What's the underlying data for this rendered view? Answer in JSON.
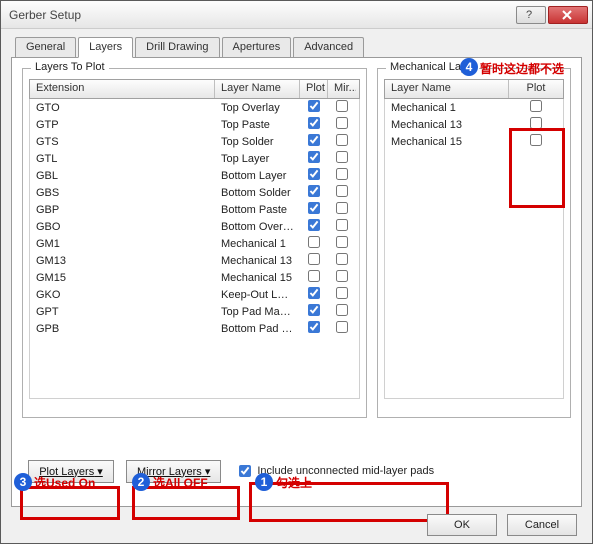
{
  "window": {
    "title": "Gerber Setup"
  },
  "tabs": [
    "General",
    "Layers",
    "Drill Drawing",
    "Apertures",
    "Advanced"
  ],
  "activeTab": "Layers",
  "leftGroup": {
    "legend": "Layers To Plot",
    "headers": {
      "ext": "Extension",
      "lname": "Layer Name",
      "plot": "Plot",
      "mir": "Mir..."
    },
    "rows": [
      {
        "ext": "GTO",
        "lname": "Top Overlay",
        "plot": true,
        "mir": false
      },
      {
        "ext": "GTP",
        "lname": "Top Paste",
        "plot": true,
        "mir": false
      },
      {
        "ext": "GTS",
        "lname": "Top Solder",
        "plot": true,
        "mir": false
      },
      {
        "ext": "GTL",
        "lname": "Top Layer",
        "plot": true,
        "mir": false
      },
      {
        "ext": "GBL",
        "lname": "Bottom Layer",
        "plot": true,
        "mir": false
      },
      {
        "ext": "GBS",
        "lname": "Bottom Solder",
        "plot": true,
        "mir": false
      },
      {
        "ext": "GBP",
        "lname": "Bottom Paste",
        "plot": true,
        "mir": false
      },
      {
        "ext": "GBO",
        "lname": "Bottom Overlay",
        "plot": true,
        "mir": false
      },
      {
        "ext": "GM1",
        "lname": "Mechanical 1",
        "plot": false,
        "mir": false
      },
      {
        "ext": "GM13",
        "lname": "Mechanical 13",
        "plot": false,
        "mir": false
      },
      {
        "ext": "GM15",
        "lname": "Mechanical 15",
        "plot": false,
        "mir": false
      },
      {
        "ext": "GKO",
        "lname": "Keep-Out Layer",
        "plot": true,
        "mir": false
      },
      {
        "ext": "GPT",
        "lname": "Top Pad Master",
        "plot": true,
        "mir": false
      },
      {
        "ext": "GPB",
        "lname": "Bottom Pad Master",
        "plot": true,
        "mir": false
      }
    ]
  },
  "rightGroup": {
    "legend": "Mechanical Lay...",
    "headers": {
      "lname": "Layer Name",
      "plot": "Plot"
    },
    "rows": [
      {
        "lname": "Mechanical 1",
        "plot": false
      },
      {
        "lname": "Mechanical 13",
        "plot": false
      },
      {
        "lname": "Mechanical 15",
        "plot": false
      }
    ]
  },
  "buttons": {
    "plotLayers": "Plot Layers",
    "mirrorLayers": "Mirror Layers",
    "includeUnconnected": "Include unconnected mid-layer pads",
    "includeChecked": true,
    "ok": "OK",
    "cancel": "Cancel"
  },
  "annotations": {
    "n1": "1",
    "t1": "勾选上",
    "n2": "2",
    "t2": "选All OFF",
    "n3": "3",
    "t3": "选Used On",
    "n4": "4",
    "t4": "暂时这边都不选"
  }
}
